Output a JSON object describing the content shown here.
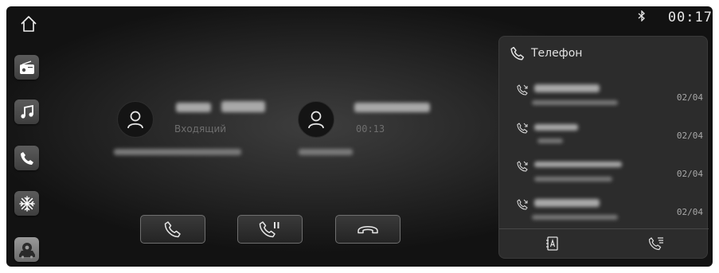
{
  "status_bar": {
    "bluetooth_icon": "bluetooth-icon",
    "time": "00:17"
  },
  "sidebar": {
    "items": [
      {
        "name": "home",
        "icon": "home-icon"
      },
      {
        "name": "radio",
        "icon": "radio-icon"
      },
      {
        "name": "music",
        "icon": "music-note-icon"
      },
      {
        "name": "phone",
        "icon": "phone-icon"
      },
      {
        "name": "climate",
        "icon": "snowflake-icon"
      },
      {
        "name": "vehicle-settings",
        "icon": "car-gear-icon"
      }
    ]
  },
  "calls": [
    {
      "state": "Входящий",
      "name_redacted": true,
      "number_redacted": true
    },
    {
      "state": "00:13",
      "name_redacted": true,
      "number_redacted": true
    }
  ],
  "call_controls": [
    {
      "name": "answer",
      "icon": "phone-answer-icon"
    },
    {
      "name": "hold",
      "icon": "phone-pause-icon"
    },
    {
      "name": "hang-up",
      "icon": "phone-hangup-icon"
    }
  ],
  "phone_panel": {
    "title": "Телефон",
    "recents": [
      {
        "type": "missed",
        "date": "02/04"
      },
      {
        "type": "missed",
        "date": "02/04"
      },
      {
        "type": "missed",
        "date": "02/04"
      },
      {
        "type": "missed",
        "date": "02/04"
      }
    ],
    "footer": [
      {
        "name": "contacts",
        "icon": "contacts-icon"
      },
      {
        "name": "call-log",
        "icon": "call-log-icon"
      }
    ]
  },
  "colors": {
    "background": "#1e1e1e",
    "panel": "#2c2c2c",
    "text": "#e2e2e2",
    "muted": "#6e6e6e"
  }
}
